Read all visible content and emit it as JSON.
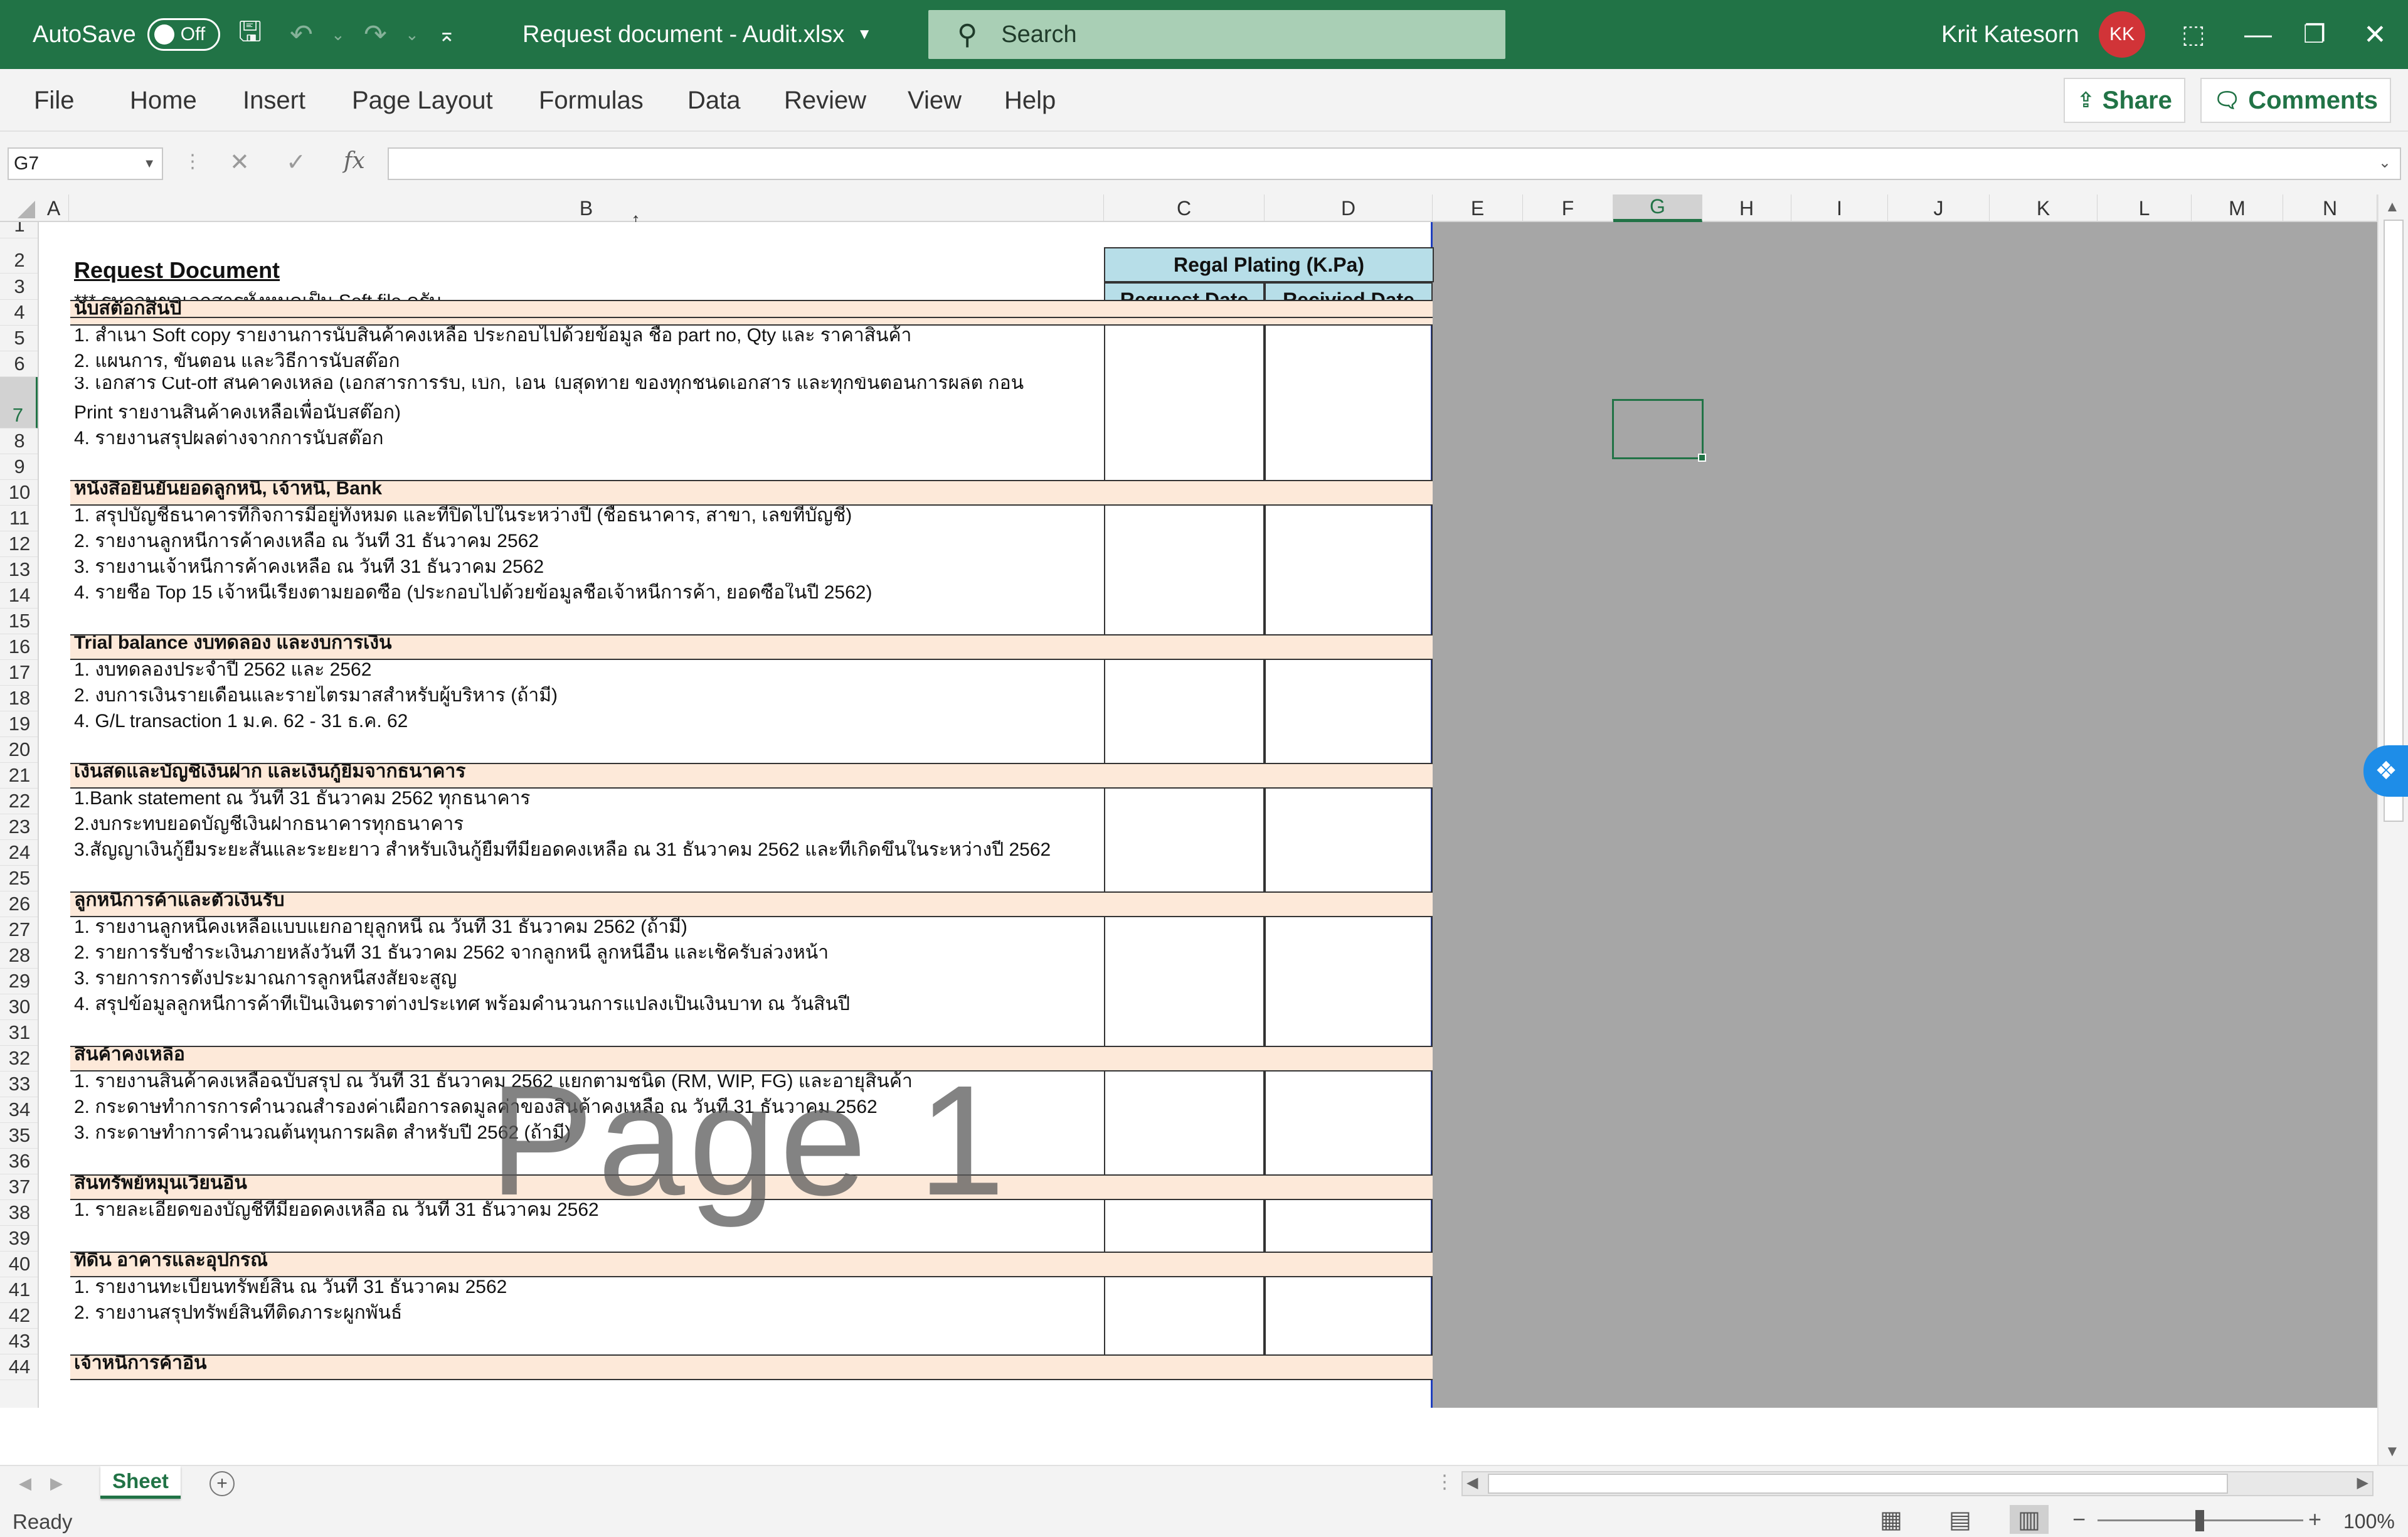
{
  "titlebar": {
    "autosave_label": "AutoSave",
    "autosave_state": "Off",
    "document_title": "Request document - Audit.xlsx",
    "search_placeholder": "Search",
    "user_name": "Krit Katesorn",
    "user_initials": "KK"
  },
  "ribbon": {
    "tabs": [
      "File",
      "Home",
      "Insert",
      "Page Layout",
      "Formulas",
      "Data",
      "Review",
      "View",
      "Help"
    ],
    "share_label": "Share",
    "comments_label": "Comments"
  },
  "formula_bar": {
    "name_box": "G7",
    "fx_label": "fx",
    "formula_value": ""
  },
  "columns": [
    "A",
    "B",
    "C",
    "D",
    "E",
    "F",
    "G",
    "H",
    "I",
    "J",
    "K",
    "L",
    "M",
    "N"
  ],
  "selected_cell": "G7",
  "sheet": {
    "title": "Request Document",
    "note": "*** รบกวนขอเอกสารทั้งหมดเป็น Soft file ครับ",
    "client_header": "Regal Plating  (K.Pa)",
    "col_c_header": "Request Date",
    "col_d_header": "Recivied Date",
    "rows": [
      {
        "n": "1",
        "text": "",
        "type": "blank"
      },
      {
        "n": "2",
        "text": "",
        "type": "title"
      },
      {
        "n": "3",
        "text": "",
        "type": "note"
      },
      {
        "n": "4",
        "text": "นับสต๊อกสิ้นปี",
        "type": "section"
      },
      {
        "n": "5",
        "text": "1. สำเนา Soft copy รายงานการนับสินค้าคงเหลือ ประกอบไปด้วยข้อมูล ชื่อ part no, Qty และ ราคาสินค้า",
        "type": "item"
      },
      {
        "n": "6",
        "text": "2. แผนการ, ขั้นตอน และวิธีการนับสต๊อก",
        "type": "item"
      },
      {
        "n": "7",
        "text": "3. เอกสาร Cut-off สินค้าคงเหลือ (เอกสารการรับ, เบิก, โอน ใบสุดท้าย ของทุกชนิดเอกสาร และทุกขั้นตอนการผลิต ก่อน",
        "text2": "Print รายงานสินค้าคงเหลือเพื่อนับสต๊อก)",
        "type": "item2"
      },
      {
        "n": "8",
        "text": "4. รายงานสรุปผลต่างจากการนับสต๊อก",
        "type": "item"
      },
      {
        "n": "9",
        "text": "",
        "type": "item"
      },
      {
        "n": "10",
        "text": " หนังสือยืนยันยอดลูกหนี้, เจ้าหนี้, Bank",
        "type": "section"
      },
      {
        "n": "11",
        "text": "1. สรุปบัญชีธนาคารที่กิจการมีอยู่ทั้งหมด และที่ปิดไปในระหว่างปี (ชื่อธนาคาร, สาขา, เลขที่บัญชี)",
        "type": "item"
      },
      {
        "n": "12",
        "text": "2. รายงานลูกหนี้การค้าคงเหลือ ณ วันที่ 31 ธันวาคม 2562",
        "type": "item"
      },
      {
        "n": "13",
        "text": "3. รายงานเจ้าหนี้การค้าคงเหลือ ณ วันที่ 31 ธันวาคม 2562",
        "type": "item"
      },
      {
        "n": "14",
        "text": "4. รายชื่อ Top 15 เจ้าหนี้เรียงตามยอดซื้อ (ประกอบไปด้วยข้อมูลชื่อเจ้าหนี้การค้า, ยอดซื้อในปี 2562)",
        "type": "item"
      },
      {
        "n": "15",
        "text": "",
        "type": "item"
      },
      {
        "n": "16",
        "text": "Trial balance งบทดลอง และงบการเงิน",
        "type": "section"
      },
      {
        "n": "17",
        "text": "1. งบทดลองประจำปี 2562 และ 2562",
        "type": "item"
      },
      {
        "n": "18",
        "text": "2. งบการเงินรายเดือนและรายไตรมาสสำหรับผู้บริหาร (ถ้ามี)",
        "type": "item"
      },
      {
        "n": "19",
        "text": "4. G/L transaction 1 ม.ค. 62 - 31 ธ.ค. 62",
        "type": "item"
      },
      {
        "n": "20",
        "text": "",
        "type": "item"
      },
      {
        "n": "21",
        "text": "เงินสดและบัญชีเงินฝาก และเงินกู้ยืมจากธนาคาร",
        "type": "section"
      },
      {
        "n": "22",
        "text": "1.Bank statement ณ วันที่ 31 ธันวาคม 2562 ทุกธนาคาร",
        "type": "item"
      },
      {
        "n": "23",
        "text": "2.งบกระทบยอดบัญชีเงินฝากธนาคารทุกธนาคาร",
        "type": "item"
      },
      {
        "n": "24",
        "text": "3.สัญญาเงินกู้ยืมระยะสั้นและระยะยาว สำหรับเงินกู้ยืมที่มียอดคงเหลือ ณ 31 ธันวาคม 2562 และที่เกิดขึ้นในระหว่างปี 2562",
        "type": "item"
      },
      {
        "n": "25",
        "text": "",
        "type": "item"
      },
      {
        "n": "26",
        "text": "ลูกหนี้การค้าและตั๋วเงินรับ",
        "type": "section"
      },
      {
        "n": "27",
        "text": "1. รายงานลูกหนี้คงเหลือแบบแยกอายุลูกหนี้ ณ วันที่  31 ธันวาคม 2562 (ถ้ามี)",
        "type": "item"
      },
      {
        "n": "28",
        "text": "2. รายการรับชำระเงินภายหลังวันที่ 31 ธันวาคม  2562 จากลูกหนี้ ลูกหนี้อื่น และเช็ครับล่วงหน้า",
        "type": "item"
      },
      {
        "n": "29",
        "text": "3. รายการการตั้งประมาณการลูกหนี้สงสัยจะสูญ",
        "type": "item"
      },
      {
        "n": "30",
        "text": "4. สรุปข้อมูลลูกหนี้การค้าที่เป็นเงินตราต่างประเทศ พร้อมคำนวนการแปลงเป็นเงินบาท ณ วันสิ้นปี",
        "type": "item"
      },
      {
        "n": "31",
        "text": "",
        "type": "item"
      },
      {
        "n": "32",
        "text": "สินค้าคงเหลือ",
        "type": "section"
      },
      {
        "n": "33",
        "text": "1. รายงานสินค้าคงเหลือฉบับสรุป ณ วันที่ 31 ธันวาคม 2562 แยกตามชนิด (RM, WIP, FG) และอายุสินค้า",
        "type": "item"
      },
      {
        "n": "34",
        "text": "2. กระดาษทำการการคำนวณสำรองค่าเผื่อการลดมูลค่าของสินค้าคงเหลือ ณ วันที่ 31 ธันวาคม 2562",
        "type": "item"
      },
      {
        "n": "35",
        "text": "3. กระดาษทำการคำนวณต้นทุนการผลิต สำหรับปี 2562 (ถ้ามี)",
        "type": "item"
      },
      {
        "n": "36",
        "text": "",
        "type": "item"
      },
      {
        "n": "37",
        "text": "สินทรัพย์หมุนเวียนอื่น",
        "type": "section"
      },
      {
        "n": "38",
        "text": "1. รายละเอียดของบัญชีที่มียอดคงเหลือ ณ วันที่ 31 ธันวาคม 2562",
        "type": "item"
      },
      {
        "n": "39",
        "text": "",
        "type": "item"
      },
      {
        "n": "40",
        "text": "ที่ดิน อาคารและอุปกรณ์",
        "type": "section"
      },
      {
        "n": "41",
        "text": "1. รายงานทะเบียนทรัพย์สิน ณ วันที่  31 ธันวาคม 2562",
        "type": "item"
      },
      {
        "n": "42",
        "text": "2. รายงานสรุปทรัพย์สินที่ติดภาระผูกพันธ์",
        "type": "item"
      },
      {
        "n": "43",
        "text": "",
        "type": "item"
      },
      {
        "n": "44",
        "text": "เจ้าหนี้การค้าอื่น",
        "type": "section"
      }
    ]
  },
  "watermark": "Page 1",
  "sheet_tabs": [
    "Sheet"
  ],
  "status": {
    "ready": "Ready",
    "zoom": "100%"
  },
  "colors": {
    "excel_green": "#217346",
    "section_fill": "#fde9d9",
    "header_fill": "#b7dee8",
    "page_border": "#1f3fbf"
  }
}
